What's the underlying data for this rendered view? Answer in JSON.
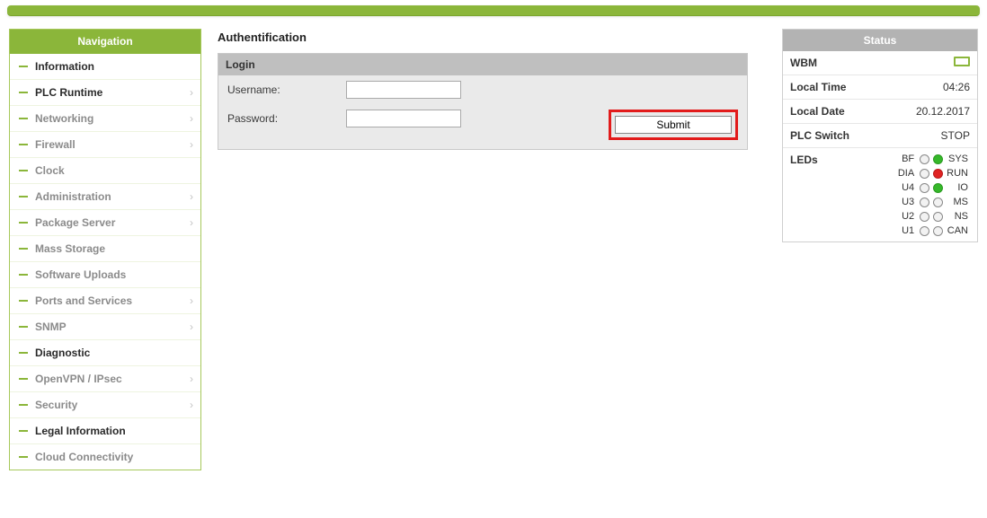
{
  "nav": {
    "title": "Navigation",
    "items": [
      {
        "label": "Information",
        "active": true,
        "arrow": false
      },
      {
        "label": "PLC Runtime",
        "active": true,
        "arrow": true
      },
      {
        "label": "Networking",
        "active": false,
        "arrow": true
      },
      {
        "label": "Firewall",
        "active": false,
        "arrow": true
      },
      {
        "label": "Clock",
        "active": false,
        "arrow": false
      },
      {
        "label": "Administration",
        "active": false,
        "arrow": true
      },
      {
        "label": "Package Server",
        "active": false,
        "arrow": true
      },
      {
        "label": "Mass Storage",
        "active": false,
        "arrow": false
      },
      {
        "label": "Software Uploads",
        "active": false,
        "arrow": false
      },
      {
        "label": "Ports and Services",
        "active": false,
        "arrow": true
      },
      {
        "label": "SNMP",
        "active": false,
        "arrow": true
      },
      {
        "label": "Diagnostic",
        "active": true,
        "arrow": false
      },
      {
        "label": "OpenVPN / IPsec",
        "active": false,
        "arrow": true
      },
      {
        "label": "Security",
        "active": false,
        "arrow": true
      },
      {
        "label": "Legal Information",
        "active": true,
        "arrow": false
      },
      {
        "label": "Cloud Connectivity",
        "active": false,
        "arrow": false
      }
    ]
  },
  "page": {
    "title": "Authentification",
    "panel_title": "Login",
    "username_label": "Username:",
    "password_label": "Password:",
    "username_value": "",
    "password_value": "",
    "submit_label": "Submit"
  },
  "status": {
    "title": "Status",
    "rows": [
      {
        "key": "WBM",
        "val": ""
      },
      {
        "key": "Local Time",
        "val": "04:26"
      },
      {
        "key": "Local Date",
        "val": "20.12.2017"
      },
      {
        "key": "PLC Switch",
        "val": "STOP"
      },
      {
        "key": "LEDs",
        "val": ""
      }
    ],
    "leds": [
      {
        "l1": "BF",
        "c1": "",
        "l2": "SYS",
        "c2": "green"
      },
      {
        "l1": "DIA",
        "c1": "",
        "l2": "RUN",
        "c2": "red"
      },
      {
        "l1": "U4",
        "c1": "",
        "l2": "IO",
        "c2": "green"
      },
      {
        "l1": "U3",
        "c1": "",
        "l2": "MS",
        "c2": ""
      },
      {
        "l1": "U2",
        "c1": "",
        "l2": "NS",
        "c2": ""
      },
      {
        "l1": "U1",
        "c1": "",
        "l2": "CAN",
        "c2": ""
      }
    ]
  }
}
